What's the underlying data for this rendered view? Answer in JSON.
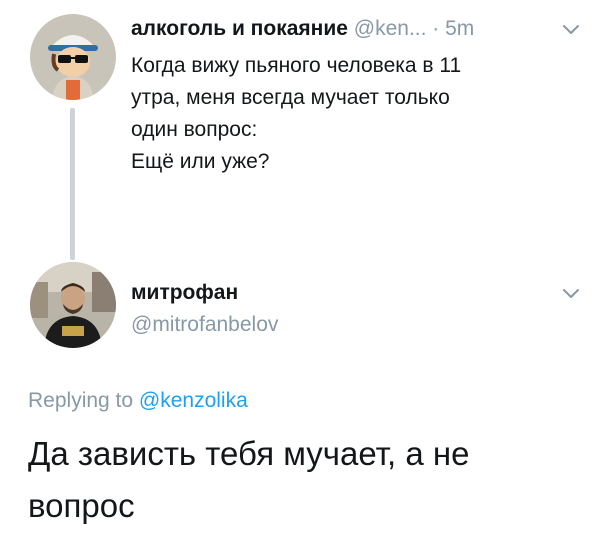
{
  "parent_tweet": {
    "author_name": "алкоголь и покаяние",
    "author_handle": "@ken...",
    "time": "· 5m",
    "lines": [
      "Когда вижу пьяного человека в 11",
      "утра, меня всегда мучает только",
      "один вопрос:",
      "Ещё или уже?"
    ],
    "avatar_icon": "cartoon-character-avatar",
    "menu_icon": "chevron-down-icon"
  },
  "reply_tweet": {
    "author_name": "митрофан",
    "author_handle": "@mitrofanbelov",
    "avatar_icon": "profile-photo-avatar",
    "menu_icon": "chevron-down-icon",
    "replying_to_label": "Replying to",
    "replying_to_handle": "@kenzolika",
    "lines": [
      "Да зависть тебя мучает, а не",
      "вопрос"
    ]
  },
  "colors": {
    "text_primary": "#14171a",
    "text_secondary": "#8899a6",
    "link": "#1da1f2",
    "thread_line": "#cdd3d8"
  }
}
